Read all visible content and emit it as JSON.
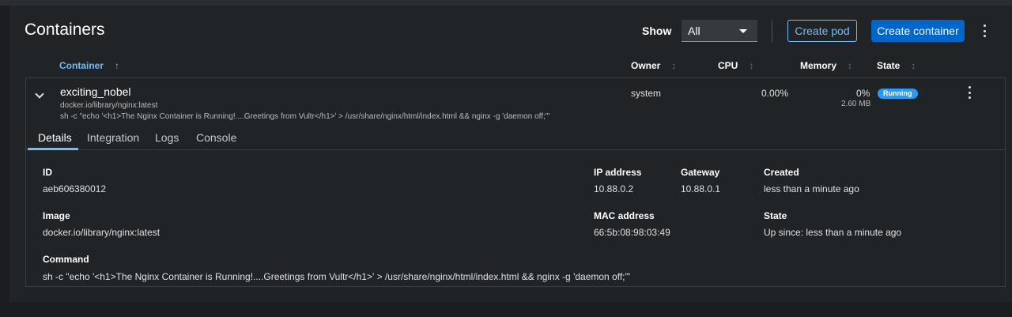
{
  "header": {
    "title": "Containers",
    "show_label": "Show",
    "show_value": "All",
    "create_pod": "Create pod",
    "create_container": "Create container"
  },
  "columns": {
    "container": "Container",
    "owner": "Owner",
    "cpu": "CPU",
    "memory": "Memory",
    "state": "State",
    "sort_icon": "↑",
    "sort_idle_icon": "↕"
  },
  "row": {
    "name": "exciting_nobel",
    "image": "docker.io/library/nginx:latest",
    "command": "sh -c \"echo '<h1>The Nginx Container is Running!....Greetings from Vultr</h1>' > /usr/share/nginx/html/index.html && nginx -g 'daemon off;'\"",
    "owner": "system",
    "cpu": "0.00%",
    "memory_percent": "0%",
    "memory_size": "2.60 MB",
    "state": "Running"
  },
  "tabs": [
    "Details",
    "Integration",
    "Logs",
    "Console"
  ],
  "details": {
    "id_label": "ID",
    "id_value": "aeb606380012",
    "ip_label": "IP address",
    "ip_value": "10.88.0.2",
    "gateway_label": "Gateway",
    "gateway_value": "10.88.0.1",
    "created_label": "Created",
    "created_value": "less than a minute ago",
    "image_label": "Image",
    "image_value": "docker.io/library/nginx:latest",
    "mac_label": "MAC address",
    "mac_value": "66:5b:08:98:03:49",
    "state_label": "State",
    "state_value": "Up since: less than a minute ago",
    "command_label": "Command",
    "command_value": "sh -c \"echo '<h1>The Nginx Container is Running!....Greetings from Vultr</h1>' > /usr/share/nginx/html/index.html && nginx -g 'daemon off;'\""
  },
  "icons": {
    "kebab": "kebab-icon",
    "chevron": "chevron-down-icon",
    "caret": "caret-down-icon"
  },
  "colors": {
    "accent": "#73bcf7",
    "primary": "#0066cc",
    "running": "#2b9af3"
  }
}
